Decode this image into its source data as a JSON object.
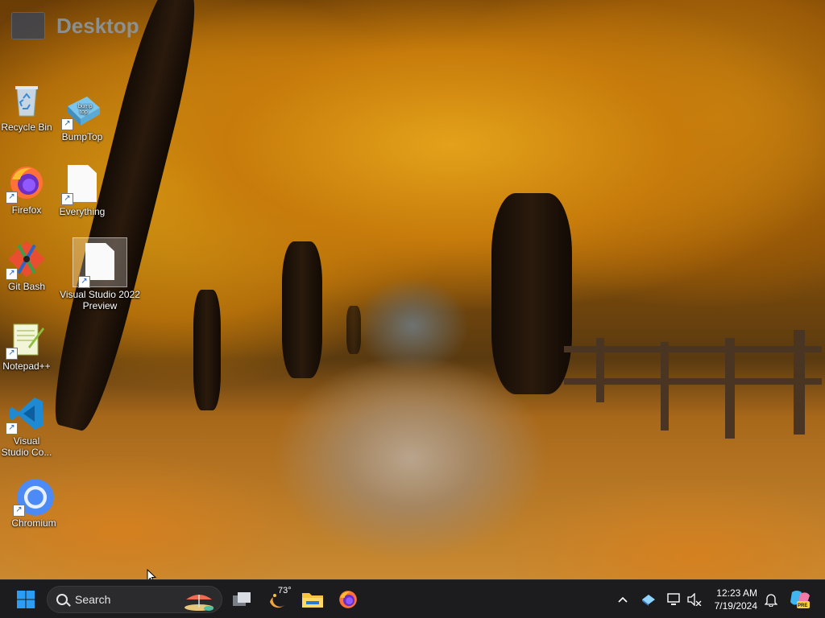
{
  "window_title": "Desktop",
  "desktop_icons": [
    {
      "label": "Recycle Bin",
      "icon": "recycle-bin-icon"
    },
    {
      "label": "BumpTop",
      "icon": "bumptop-icon"
    },
    {
      "label": "Firefox",
      "icon": "firefox-icon"
    },
    {
      "label": "Everything",
      "icon": "generic-file-icon"
    },
    {
      "label": "Git Bash",
      "icon": "git-bash-icon"
    },
    {
      "label": "Visual Studio 2022 Preview",
      "icon": "generic-file-icon"
    },
    {
      "label": "Notepad++",
      "icon": "notepad-plus-plus-icon"
    },
    {
      "label": "Visual Studio Co...",
      "icon": "vscode-icon"
    },
    {
      "label": "Chromium",
      "icon": "chromium-icon"
    }
  ],
  "taskbar": {
    "search_label": "Search",
    "weather_temp": "73°",
    "pinned": [
      "task-view-icon",
      "weather-icon",
      "file-explorer-icon",
      "firefox-icon"
    ],
    "clock_time": "12:23 AM",
    "clock_date": "7/19/2024",
    "tray_icons": [
      "chevron-up-icon",
      "network-drive-icon",
      "display-icon",
      "muted-speaker-icon",
      "bell-icon",
      "copilot-pre-icon"
    ]
  },
  "colors": {
    "taskbar_bg": "#1c1c1e",
    "start_blue": "#2a9df4",
    "vscode_blue": "#1f8ad2",
    "chromium_blue": "#4c8bf5",
    "firefox_orange": "#ff7139",
    "explorer_yellow": "#f5c342"
  }
}
